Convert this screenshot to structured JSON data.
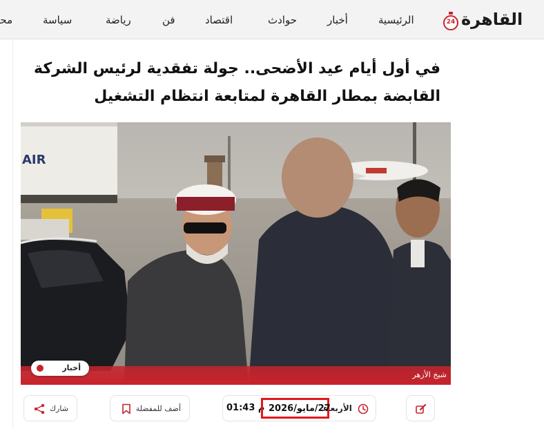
{
  "site": {
    "logo_text": "القاهرة",
    "logo_badge": "24"
  },
  "nav": {
    "items": [
      {
        "label": "الرئيسية"
      },
      {
        "label": "أخبار"
      },
      {
        "label": "حوادث"
      },
      {
        "label": "اقتصاد"
      },
      {
        "label": "فن"
      },
      {
        "label": "رياضة"
      },
      {
        "label": "سياسة"
      },
      {
        "label": "محـ"
      }
    ]
  },
  "article": {
    "title_line1": "في أول أيام عيد الأضحى.. جولة تفقدية لرئيس الشركة",
    "title_line2": "القابضة بمطار القاهرة لمتابعة انتظام التشغيل",
    "image_caption": "شيخ الأزهر",
    "category_tag": "أخبار",
    "day_label": "الأربعاء",
    "date": "27/مايو/2026",
    "time": "01:43 م",
    "bookmark_label": "أضف للمفضلة",
    "share_label": "شارك"
  },
  "colors": {
    "accent": "#c8232c",
    "highlight_box": "#e0181c",
    "nav_bg": "#f3f3f3"
  },
  "icons": [
    "edit-icon",
    "clock-icon",
    "bookmark-icon",
    "share-icon"
  ]
}
